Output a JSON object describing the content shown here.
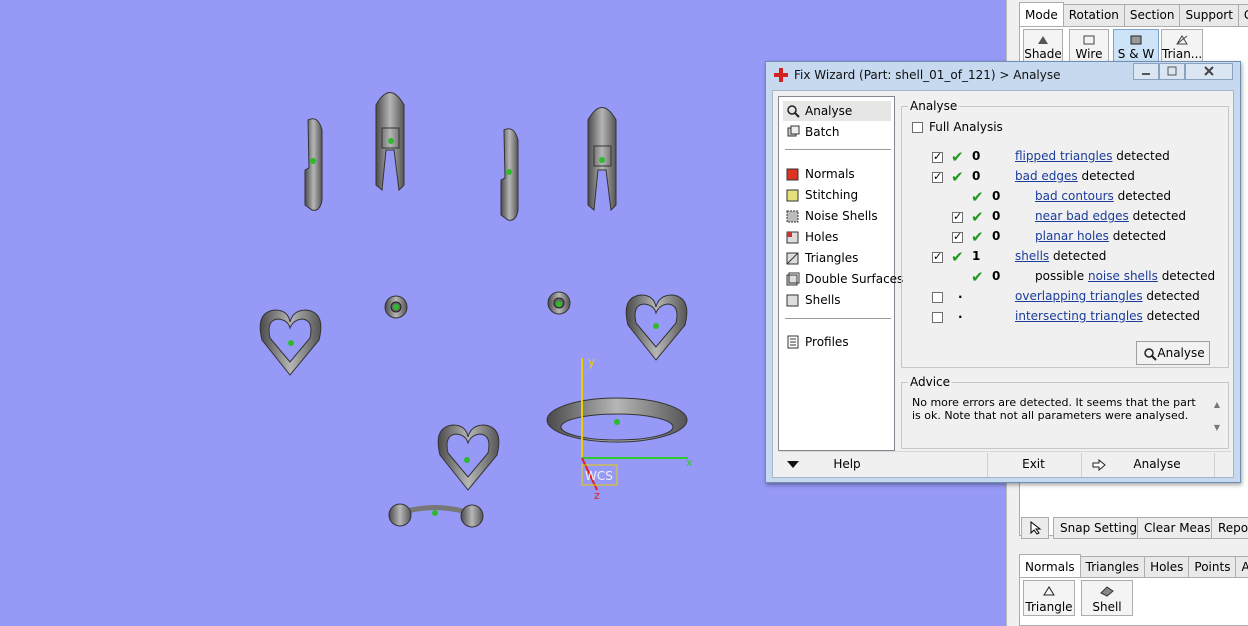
{
  "viewport": {
    "background": "#9799f6",
    "axis": {
      "y_label": "y",
      "x_label": "x",
      "z_label": "z",
      "wcs_label": "WCS"
    }
  },
  "right_panel": {
    "top_tabs": [
      "Mode",
      "Rotation",
      "Section",
      "Support",
      "Grid"
    ],
    "mode_buttons": [
      "Shade",
      "Wire",
      "S & W",
      "Trian..."
    ],
    "bottom_toolbar": {
      "snap_settings": "Snap Settings",
      "clear_meas": "Clear Meas.",
      "report": "Report"
    },
    "bottom_tabs": [
      "Normals",
      "Triangles",
      "Holes",
      "Points",
      "Auto"
    ],
    "bottom_buttons": [
      "Triangle",
      "Shell"
    ]
  },
  "dialog": {
    "title": "Fix Wizard (Part: shell_01_of_121) > Analyse",
    "nav_top": [
      "Analyse",
      "Batch"
    ],
    "nav_mid": [
      "Normals",
      "Stitching",
      "Noise Shells",
      "Holes",
      "Triangles",
      "Double Surfaces",
      "Shells"
    ],
    "nav_bottom": [
      "Profiles"
    ],
    "analyse_group": "Analyse",
    "full_analysis": "Full Analysis",
    "rows": [
      {
        "checked": true,
        "value": "0",
        "link": "flipped triangles",
        "suffix": "detected",
        "prefix": ""
      },
      {
        "checked": true,
        "value": "0",
        "link": "bad edges",
        "suffix": "detected",
        "prefix": ""
      },
      {
        "checked": null,
        "value": "0",
        "link": "bad contours",
        "suffix": "detected",
        "prefix": ""
      },
      {
        "checked": true,
        "value": "0",
        "link": "near bad edges",
        "suffix": "detected",
        "prefix": ""
      },
      {
        "checked": true,
        "value": "0",
        "link": "planar holes",
        "suffix": "detected",
        "prefix": ""
      },
      {
        "checked": true,
        "value": "1",
        "link": "shells",
        "suffix": "detected",
        "prefix": ""
      },
      {
        "checked": null,
        "value": "0",
        "link": "noise shells",
        "suffix": "detected",
        "prefix": "possible"
      },
      {
        "checked": false,
        "value": ".",
        "link": "overlapping triangles",
        "suffix": "detected",
        "prefix": ""
      },
      {
        "checked": false,
        "value": ".",
        "link": "intersecting triangles",
        "suffix": "detected",
        "prefix": ""
      }
    ],
    "analyse_button": "Analyse",
    "advice_group": "Advice",
    "advice_text": "No more errors are detected. It seems that the part is ok. Note that not all parameters were analysed.",
    "help_button": "Help",
    "exit_button": "Exit",
    "bottom_analyse_button": "Analyse"
  }
}
